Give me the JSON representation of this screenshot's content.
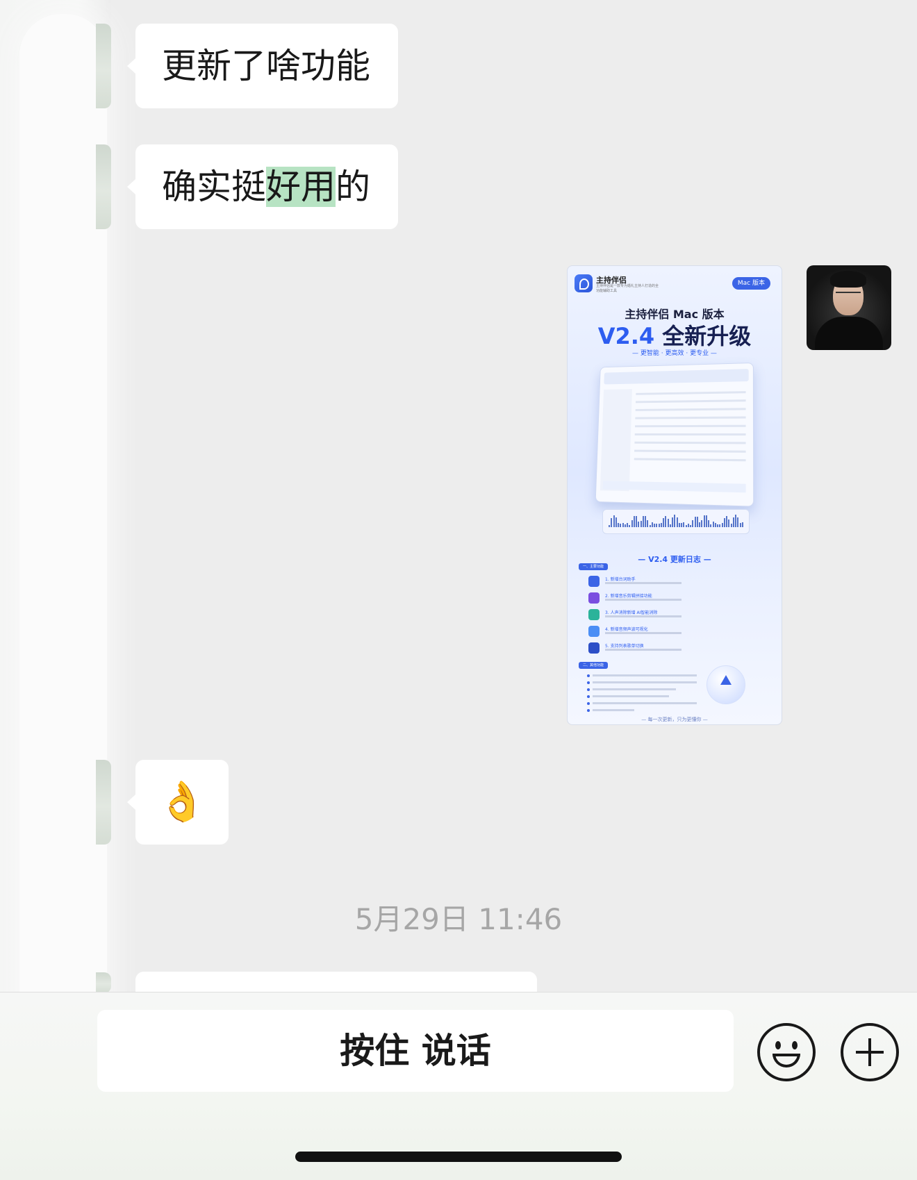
{
  "messages": [
    {
      "side": "left",
      "type": "text",
      "text": "更新了啥功能"
    },
    {
      "side": "left",
      "type": "text",
      "text_before": "确实挺",
      "highlight": "好用",
      "text_after": "的"
    },
    {
      "side": "right",
      "type": "image"
    },
    {
      "side": "left",
      "type": "emoji",
      "emoji": "👌"
    }
  ],
  "poster": {
    "brand": "主持伴侣",
    "brand_sub": "主持伴侣是一款专为婚礼主持人打造的全功能辅助工具",
    "mac_badge": "Mac 版本",
    "title_line1": "主持伴侣 Mac 版本",
    "version": "V2.4",
    "title_line2": "全新升级",
    "tagline": "— 更智能 · 更高效 · 更专业 —",
    "changelog_title": "— V2.4 更新日志 —",
    "section1": "一、主要功能",
    "items": [
      "1. 新增台词助手",
      "2. 新增音乐剪辑拼接功能",
      "3. 人声消除新增 AI智能消除",
      "4. 新增音频声波可视化",
      "5. 支持列表歌单切换"
    ],
    "section2": "二、其他功能",
    "footer": "— 每一次更新，只为更懂你 —"
  },
  "timestamp": "5月29日 11:46",
  "input_bar": {
    "talk_label": "按住 说话"
  },
  "icons": {
    "emoji_button": "smile-icon",
    "more_button": "plus-icon"
  },
  "colors": {
    "chat_bg": "#ededed",
    "bubble_bg": "#ffffff",
    "highlight": "#b7e3c3",
    "timestamp": "#a6a6a6"
  }
}
